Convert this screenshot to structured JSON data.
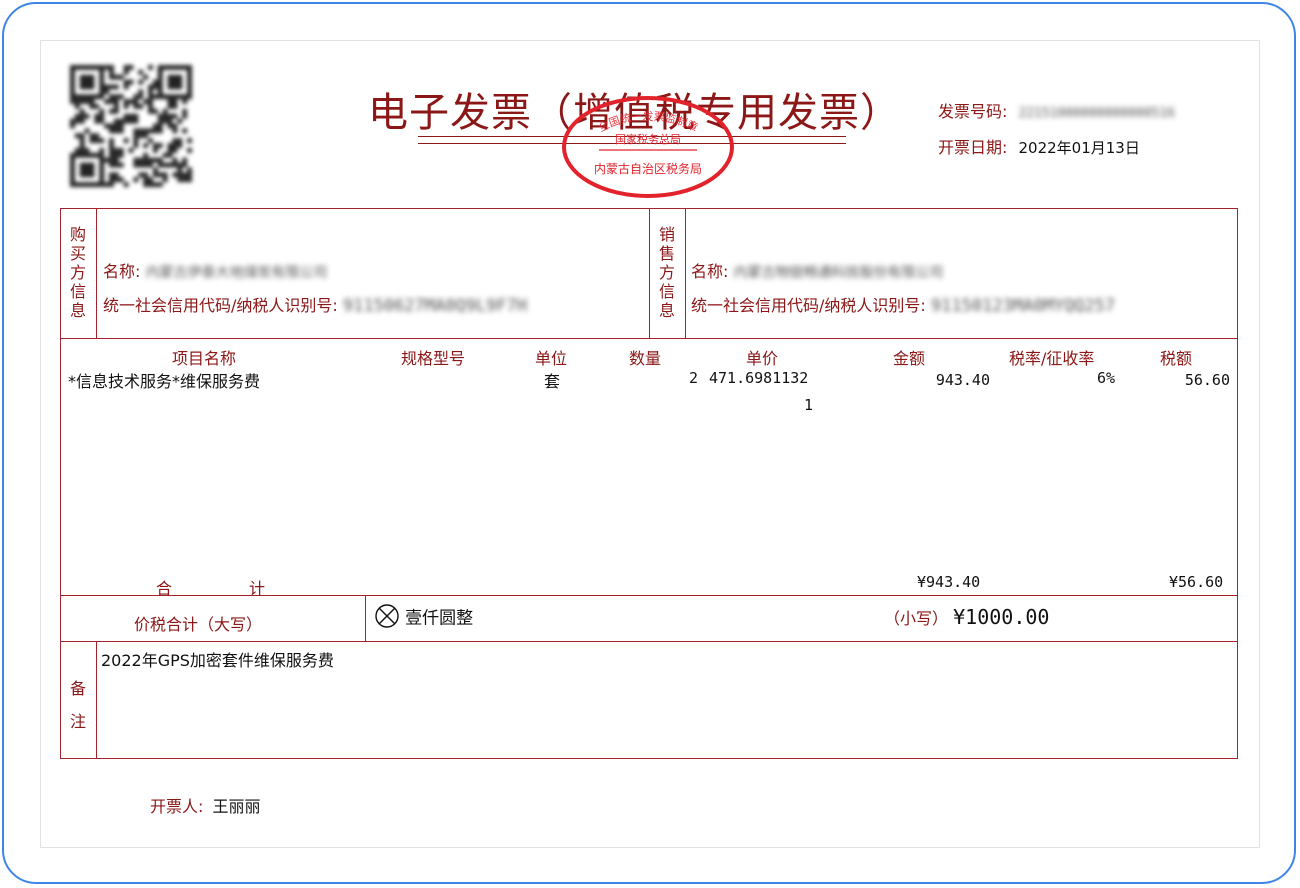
{
  "title": "电子发票（增值税专用发票）",
  "header": {
    "invoice_no_label": "发票号码:",
    "invoice_no": "22151000000000000516",
    "issue_date_label": "开票日期:",
    "issue_date": "2022年01月13日"
  },
  "stamp": {
    "top_text": "全国统一发票监制章",
    "middle_text": "国家税务总局",
    "bottom_text": "内蒙古自治区税务局"
  },
  "buyer": {
    "side_label": [
      "购",
      "买",
      "方",
      "信",
      "息"
    ],
    "name_label": "名称:",
    "name": "内蒙古伊泰大地煤炭有限公司",
    "tax_id_label": "统一社会信用代码/纳税人识别号:",
    "tax_id": "91150627MA0Q9L9F7H"
  },
  "seller": {
    "side_label": [
      "销",
      "售",
      "方",
      "信",
      "息"
    ],
    "name_label": "名称:",
    "name": "内蒙古物链畅通科技股份有限公司",
    "tax_id_label": "统一社会信用代码/纳税人识别号:",
    "tax_id": "91150123MA0MYQQ257"
  },
  "columns": {
    "item": "项目名称",
    "spec": "规格型号",
    "unit": "单位",
    "qty": "数量",
    "price": "单价",
    "amount": "金额",
    "rate": "税率/征收率",
    "tax": "税额"
  },
  "items": [
    {
      "name": "*信息技术服务*维保服务费",
      "unit": "套",
      "qty": "2",
      "price_line1": "471.6981132",
      "price_line2": "1",
      "amount": "943.40",
      "rate": "6%",
      "tax": "56.60"
    }
  ],
  "totals": {
    "label_a": "合",
    "label_b": "计",
    "amount": "¥943.40",
    "tax": "¥56.60"
  },
  "grand_total": {
    "label": "价税合计（大写）",
    "words": "壹仟圆整",
    "small_label": "（小写）",
    "small_value": "¥1000.00"
  },
  "remarks": {
    "side_label": [
      "备",
      "注"
    ],
    "text": "2022年GPS加密套件维保服务费"
  },
  "issuer": {
    "label": "开票人:",
    "name": "王丽丽"
  },
  "colors": {
    "frame": "#3d86e6",
    "label": "#8c1717",
    "line": "#a5212c",
    "stamp": "#e3232c"
  }
}
